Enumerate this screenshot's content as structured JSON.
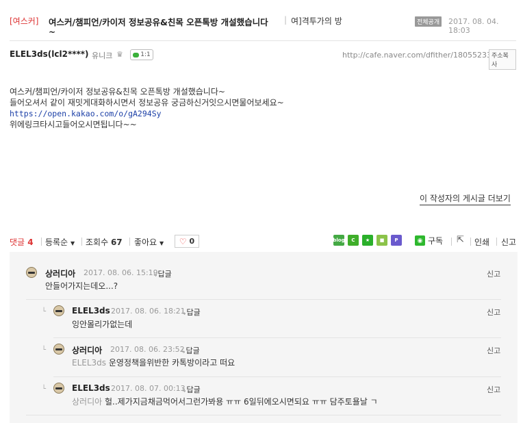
{
  "post": {
    "category": "[여스커]",
    "title": "여스커/챔피언/카이저 정보공유&친목 오픈톡방 개설했습니다",
    "title_tail": "~",
    "title_sep": "|",
    "cafe_name": "여]격투가의 방",
    "badge": "전체공개",
    "date": "2017. 08. 04. 18:03",
    "author": "ELEL3ds(lcl2****)",
    "author_level": "유니크",
    "chat_label": "1:1",
    "url": "http://cafe.naver.com/dfither/18055233",
    "copy_url_label": "주소복사",
    "body": {
      "line1": "여스커/챔피언/카이저 정보공유&친목 오픈톡방 개설했습니다~",
      "line2": "들어오셔서 같이 재밋게대화하시면서 정보공유 궁금하신거잇으시면물어보세요~",
      "link": "https://open.kakao.com/o/gA294Sy",
      "line4": "위에링크타시고들어오시면됩니다~~"
    },
    "more_posts": "이 작성자의 게시글 더보기"
  },
  "toolbar": {
    "comment_label": "댓글",
    "comment_count": "4",
    "sort": "등록순",
    "views_label": "조회수",
    "views": "67",
    "like_label": "좋아요",
    "like_count": "0",
    "share_icons": [
      {
        "name": "blog",
        "label": "blog",
        "color": "#44a944"
      },
      {
        "name": "cafe",
        "label": "C",
        "color": "#3fae2a"
      },
      {
        "name": "bookmark",
        "label": "★",
        "color": "#2bb02b"
      },
      {
        "name": "memo",
        "label": "■",
        "color": "#8bc34a"
      },
      {
        "name": "pholar",
        "label": "P",
        "color": "#6a5acd"
      }
    ],
    "subscribe": "구독",
    "print": "인쇄",
    "report": "신고"
  },
  "comments": [
    {
      "author": "상러디아",
      "date": "2017. 08. 06. 15:19",
      "reply": "답글",
      "report": "신고",
      "ref": "",
      "text": "안들어가지는데오...?"
    },
    {
      "author": "ELEL3ds",
      "date": "2017. 08. 06. 18:21",
      "reply": "답글",
      "report": "신고",
      "ref": "",
      "text": "잉안몰리가없는데"
    },
    {
      "author": "상러디아",
      "date": "2017. 08. 06. 23:52",
      "reply": "답글",
      "report": "신고",
      "ref": "ELEL3ds",
      "text": "운영정책을위반한 카톡방이라고 떠요"
    },
    {
      "author": "ELEL3ds",
      "date": "2017. 08. 07. 00:13",
      "reply": "답글",
      "report": "신고",
      "ref": "상러디아",
      "text": "헐..제가지금채금먹어서그런가봐용 ㅠㅠ 6일뒤에오시면되요 ㅠㅠ 담주토욜날 ㄱ"
    }
  ]
}
